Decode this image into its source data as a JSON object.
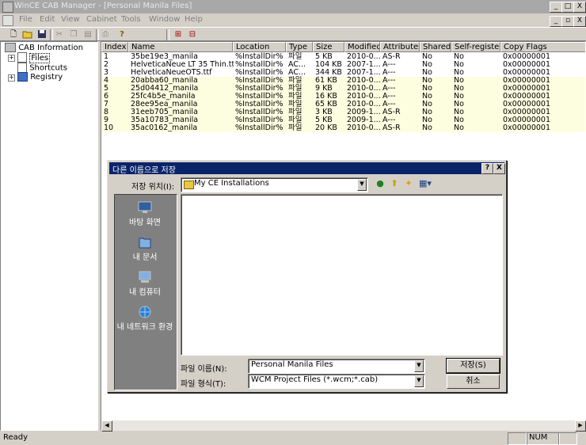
{
  "window": {
    "title": "WinCE CAB Manager - [Personal Manila Files]",
    "controls": {
      "minimize": "_",
      "maximize": "□",
      "close": "X"
    },
    "mdi_controls": {
      "minimize": "_",
      "restore": "▫",
      "close": "X"
    }
  },
  "menu": [
    "File",
    "Edit",
    "View",
    "Cabinet",
    "Tools",
    "Window",
    "Help"
  ],
  "toolbar_icons": [
    "new-icon",
    "open-icon",
    "save-icon",
    "cut-icon",
    "copy-icon",
    "paste-icon",
    "print-icon",
    "help-icon",
    "add-file-icon",
    "remove-file-icon"
  ],
  "tree": {
    "root": "CAB Information",
    "items": [
      {
        "label": "Files",
        "expander": "+"
      },
      {
        "label": "Shortcuts",
        "expander": ""
      },
      {
        "label": "Registry",
        "expander": "+"
      }
    ]
  },
  "table": {
    "columns": [
      "Index",
      "Name",
      "Location",
      "Type",
      "Size",
      "Modified",
      "Attributes",
      "Shared",
      "Self-register",
      "Copy Flags"
    ],
    "rows": [
      [
        "1",
        "35be19e3_manila",
        "%InstallDir%",
        "파일",
        "5 KB",
        "2010-0...",
        "AS-R",
        "No",
        "No",
        "0x00000001"
      ],
      [
        "2",
        "HelveticaNeue LT 35 Thin.ttf",
        "%InstallDir%",
        "AC...",
        "104 KB",
        "2007-1...",
        "A---",
        "No",
        "No",
        "0x00000001"
      ],
      [
        "3",
        "HelveticaNeueOTS.ttf",
        "%InstallDir%",
        "AC...",
        "344 KB",
        "2007-1...",
        "A---",
        "No",
        "No",
        "0x00000001"
      ],
      [
        "4",
        "20abba60_manila",
        "%InstallDir%",
        "파일",
        "61 KB",
        "2010-0...",
        "A---",
        "No",
        "No",
        "0x00000001"
      ],
      [
        "5",
        "25d04412_manila",
        "%InstallDir%",
        "파일",
        "9 KB",
        "2010-0...",
        "A---",
        "No",
        "No",
        "0x00000001"
      ],
      [
        "6",
        "25fc4b5e_manila",
        "%InstallDir%",
        "파일",
        "16 KB",
        "2010-0...",
        "A---",
        "No",
        "No",
        "0x00000001"
      ],
      [
        "7",
        "28ee95ea_manila",
        "%InstallDir%",
        "파일",
        "65 KB",
        "2010-0...",
        "A---",
        "No",
        "No",
        "0x00000001"
      ],
      [
        "8",
        "31eeb705_manila",
        "%InstallDir%",
        "파일",
        "3 KB",
        "2009-1...",
        "AS-R",
        "No",
        "No",
        "0x00000001"
      ],
      [
        "9",
        "35a10783_manila",
        "%InstallDir%",
        "파일",
        "5 KB",
        "2009-1...",
        "A---",
        "No",
        "No",
        "0x00000001"
      ],
      [
        "10",
        "35ac0162_manila",
        "%InstallDir%",
        "파일",
        "20 KB",
        "2010-0...",
        "AS-R",
        "No",
        "No",
        "0x00000001"
      ]
    ]
  },
  "status": {
    "text": "Ready",
    "num": "NUM"
  },
  "dialog": {
    "title": "다른 이름으로 저장",
    "help_btn": "?",
    "close_btn": "X",
    "save_in_label": "저장 위치(I):",
    "save_in_value": "My CE Installations",
    "places": [
      "바탕 화면",
      "내 문서",
      "내 컴퓨터",
      "내 네트워크 환경"
    ],
    "filename_label": "파일 이름(N):",
    "filename_value": "Personal Manila Files",
    "filetype_label": "파일 형식(T):",
    "filetype_value": "WCM Project Files (*.wcm;*.cab)",
    "save_button": "저장(S)",
    "cancel_button": "취소"
  },
  "colors": {
    "row_highlight": "#fdfde0",
    "dialog_title": "#0a246a",
    "places_bg": "#808080"
  }
}
